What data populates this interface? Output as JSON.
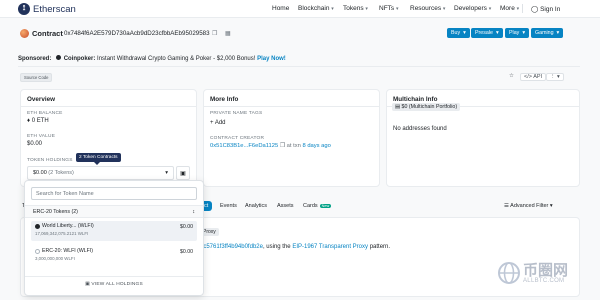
{
  "nav": {
    "brand": "Etherscan",
    "items": [
      "Home",
      "Blockchain",
      "Tokens",
      "NFTs",
      "Resources",
      "Developers",
      "More"
    ],
    "signin": "Sign In"
  },
  "contract": {
    "label": "Contract",
    "address": "0x7484f6A2E579D730aAcb9dD23cfbbAEb95029583",
    "buttons": [
      "Buy",
      "Presale",
      "Play",
      "Gaming"
    ]
  },
  "sponsored": {
    "label": "Sponsored:",
    "sponsor": "Coinpoker:",
    "text": "Instant Withdrawal Crypto Gaming & Poker - $2,000 Bonus!",
    "cta": "Play Now!"
  },
  "badge": "Source Code",
  "rightctl": {
    "api": "API",
    "more": "⋮"
  },
  "overview": {
    "title": "Overview",
    "eth_balance_label": "ETH BALANCE",
    "eth_balance": "0 ETH",
    "eth_value_label": "ETH VALUE",
    "eth_value": "$0.00",
    "token_holdings_label": "TOKEN HOLDINGS",
    "token_holdings_value": "$0.00",
    "token_holdings_count": "(2 Tokens)",
    "tooltip": "2 Token Contracts"
  },
  "moreinfo": {
    "title": "More Info",
    "private_tags_label": "PRIVATE NAME TAGS",
    "add": "+ Add",
    "creator_label": "CONTRACT CREATOR",
    "creator_addr": "0x51C83B1e...F6eDa1125",
    "creator_at": "at txn",
    "creator_time": "8 days ago"
  },
  "multichain": {
    "title": "Multichain Info",
    "pill": "$0 (Multichain Portfolio)",
    "text": "No addresses found"
  },
  "tabs": [
    {
      "label": "T",
      "active": false
    },
    {
      "label": "ct",
      "active": true
    },
    {
      "label": "Events",
      "active": false
    },
    {
      "label": "Analytics",
      "active": false
    },
    {
      "label": "Assets",
      "active": false
    },
    {
      "label": "Cards",
      "active": false,
      "badge": "New"
    }
  ],
  "advanced_filter": "Advanced Filter",
  "proxy": {
    "tag": "Proxy",
    "text_addr": "3c5761f3ff4b94b0fdb2e",
    "text_mid": ", using the ",
    "link": "EIP-1967 Transparent Proxy",
    "text_end": " pattern."
  },
  "dropdown": {
    "search_placeholder": "Search for Token Name",
    "section": "ERC-20 Tokens (2)",
    "tokens": [
      {
        "name": "World Liberty... (WLFI)",
        "sub": "17,069,342,075.2121 WLFI",
        "amount": "$0.00",
        "color": "#212529",
        "selected": true
      },
      {
        "name": "ERC-20: WLFI (WLFI)",
        "sub": "3,000,000,000 WLFI",
        "amount": "$0.00",
        "color": "#adb5bd",
        "selected": false
      }
    ],
    "view_all": "VIEW ALL HOLDINGS"
  },
  "watermark": {
    "cn": "币圈网",
    "url": "ALLBTC.COM"
  }
}
